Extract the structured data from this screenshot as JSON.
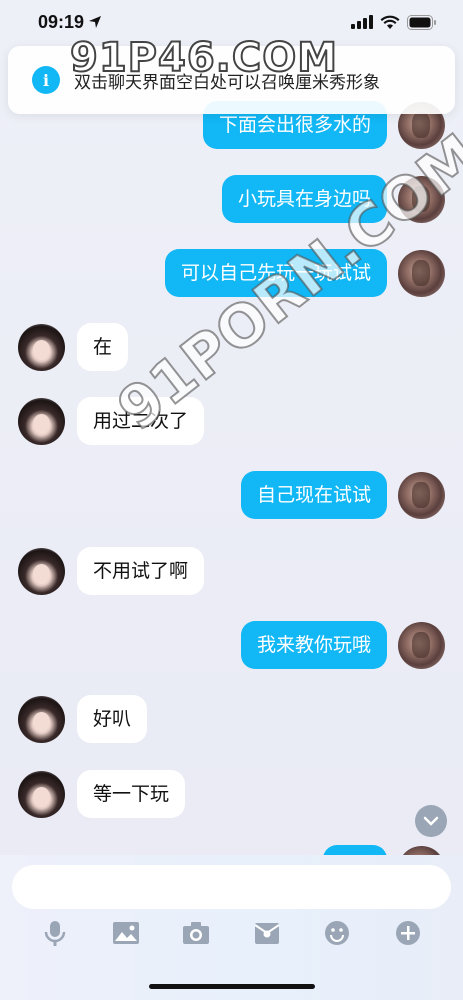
{
  "status_bar": {
    "time": "09:19"
  },
  "banner": {
    "text": "双击聊天界面空白处可以召唤厘米秀形象"
  },
  "watermark": {
    "primary": "91P46.COM",
    "secondary": "91PORN.COM"
  },
  "messages": [
    {
      "side": "out",
      "text": "下面会出很多水的"
    },
    {
      "side": "out",
      "text": "小玩具在身边吗"
    },
    {
      "side": "out",
      "text": "可以自己先玩一玩试试"
    },
    {
      "side": "in",
      "text": "在"
    },
    {
      "side": "in",
      "text": "用过二次了"
    },
    {
      "side": "out",
      "text": "自己现在试试"
    },
    {
      "side": "in",
      "text": "不用试了啊"
    },
    {
      "side": "out",
      "text": "我来教你玩哦"
    },
    {
      "side": "in",
      "text": "好叭"
    },
    {
      "side": "in",
      "text": "等一下玩"
    }
  ],
  "colors": {
    "accent": "#12b7f5",
    "incoming_bubble": "#ffffff"
  },
  "toolbar": [
    "microphone-icon",
    "image-icon",
    "camera-icon",
    "red-packet-icon",
    "emoji-icon",
    "plus-icon"
  ]
}
